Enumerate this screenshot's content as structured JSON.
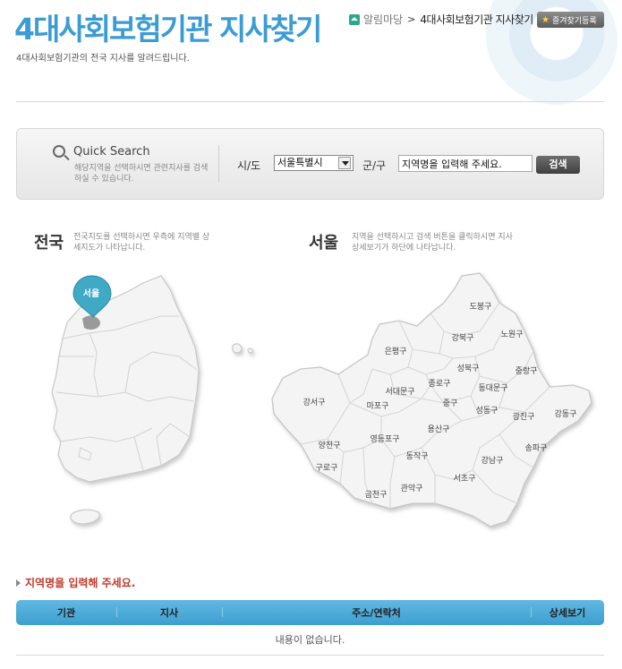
{
  "header": {
    "title": "4대사회보험기관 지사찾기",
    "subtitle": "4대사회보험기관의 전국 지사를 알려드립니다.",
    "breadcrumb": {
      "home": "알림마당",
      "separator": ">",
      "current": "4대사회보험기관 지사찾기"
    },
    "bookmark_button": "즐겨찾기등록"
  },
  "search": {
    "title": "Quick Search",
    "description": "해당지역을 선택하시면 관련지사를 검색 하실 수 있습니다.",
    "sido_label": "시/도",
    "sido_value": "서울특별시",
    "gungu_label": "군/구",
    "region_input_value": "지역명을 입력해 주세요.",
    "search_button": "검색"
  },
  "maps": {
    "national": {
      "title": "전국",
      "description": "전국지도를 선택하시면 우측에 지역별 상세지도가 나타납니다.",
      "pin_label": "서울"
    },
    "seoul": {
      "title": "서울",
      "description": "지역을 선택하시고 검색 버튼을 클릭하시면 지사 상세보기가 하단에 나타납니다.",
      "districts": [
        "도봉구",
        "강북구",
        "노원구",
        "은평구",
        "성북구",
        "중랑구",
        "종로구",
        "서대문구",
        "동대문구",
        "강서구",
        "마포구",
        "중구",
        "성동구",
        "광진구",
        "강동구",
        "용산구",
        "영등포구",
        "양천구",
        "송파구",
        "동작구",
        "강남구",
        "구로구",
        "서초구",
        "관악구",
        "금천구"
      ]
    }
  },
  "results": {
    "message": "지역명을 입력해 주세요.",
    "columns": [
      "기관",
      "지사",
      "주소/연락처",
      "상세보기"
    ],
    "empty_text": "내용이 없습니다."
  },
  "colors": {
    "title_blue": "#3b9bd4",
    "table_header": "#4aa9d6",
    "alert_red": "#c0392b",
    "pin_teal": "#3fa9c6"
  }
}
